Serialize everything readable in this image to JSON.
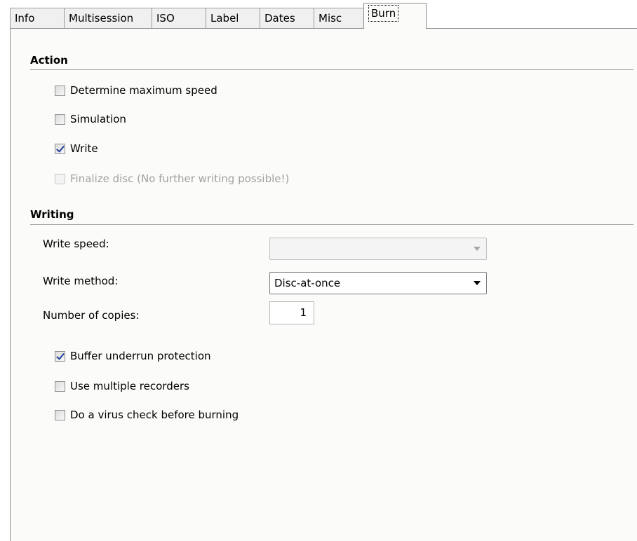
{
  "tabs": [
    {
      "label": "Info"
    },
    {
      "label": "Multisession"
    },
    {
      "label": "ISO"
    },
    {
      "label": "Label"
    },
    {
      "label": "Dates"
    },
    {
      "label": "Misc"
    },
    {
      "label": "Burn",
      "active": true
    }
  ],
  "action": {
    "title": "Action",
    "determine_max_speed": {
      "label": "Determine maximum speed",
      "checked": false
    },
    "simulation": {
      "label": "Simulation",
      "checked": false
    },
    "write": {
      "label": "Write",
      "checked": true
    },
    "finalize": {
      "label": "Finalize disc (No further writing possible!)",
      "checked": false,
      "enabled": false
    }
  },
  "writing": {
    "title": "Writing",
    "write_speed": {
      "label": "Write speed:",
      "value": "",
      "enabled": false
    },
    "write_method": {
      "label": "Write method:",
      "value": "Disc-at-once"
    },
    "copies": {
      "label": "Number of copies:",
      "value": "1"
    },
    "buffer_underrun": {
      "label": "Buffer underrun protection",
      "checked": true
    },
    "multiple_recorders": {
      "label": "Use multiple recorders",
      "checked": false
    },
    "virus_check": {
      "label": "Do a virus check before burning",
      "checked": false
    }
  },
  "icons": {
    "dropdown": "chevron-down-icon",
    "checkmark": "checkmark-icon"
  },
  "colors": {
    "page_background": "#fbfcf9",
    "checkmark": "#21409a",
    "disabled_text": "#a0a0a0"
  }
}
